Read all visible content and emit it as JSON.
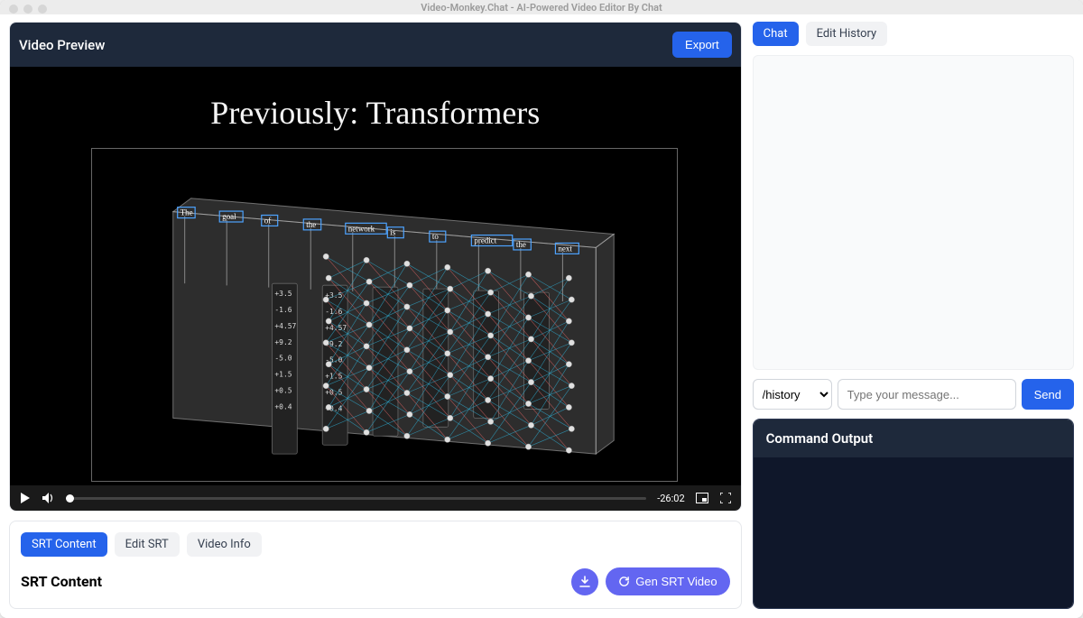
{
  "window": {
    "title": "Video-Monkey.Chat - AI-Powered Video Editor By Chat"
  },
  "preview": {
    "header_title": "Video Preview",
    "export_label": "Export",
    "frame_title": "Previously: Transformers",
    "tokens": [
      "The",
      "goal",
      "of",
      "the",
      "network",
      "is",
      "to",
      "predict",
      "the",
      "next"
    ],
    "col_values": [
      "+3.5",
      "-1.6",
      "+4.57",
      "+9.2",
      "-5.0",
      "+1.5",
      "+0.5",
      "+0.4"
    ],
    "time_remaining": "-26:02"
  },
  "srt": {
    "tabs": {
      "content": "SRT Content",
      "edit": "Edit SRT",
      "info": "Video Info"
    },
    "heading": "SRT Content",
    "gen_label": "Gen SRT Video"
  },
  "chat": {
    "tabs": {
      "chat": "Chat",
      "history": "Edit History"
    },
    "command_selected": "/history",
    "placeholder": "Type your message...",
    "send_label": "Send"
  },
  "output": {
    "header": "Command Output"
  }
}
